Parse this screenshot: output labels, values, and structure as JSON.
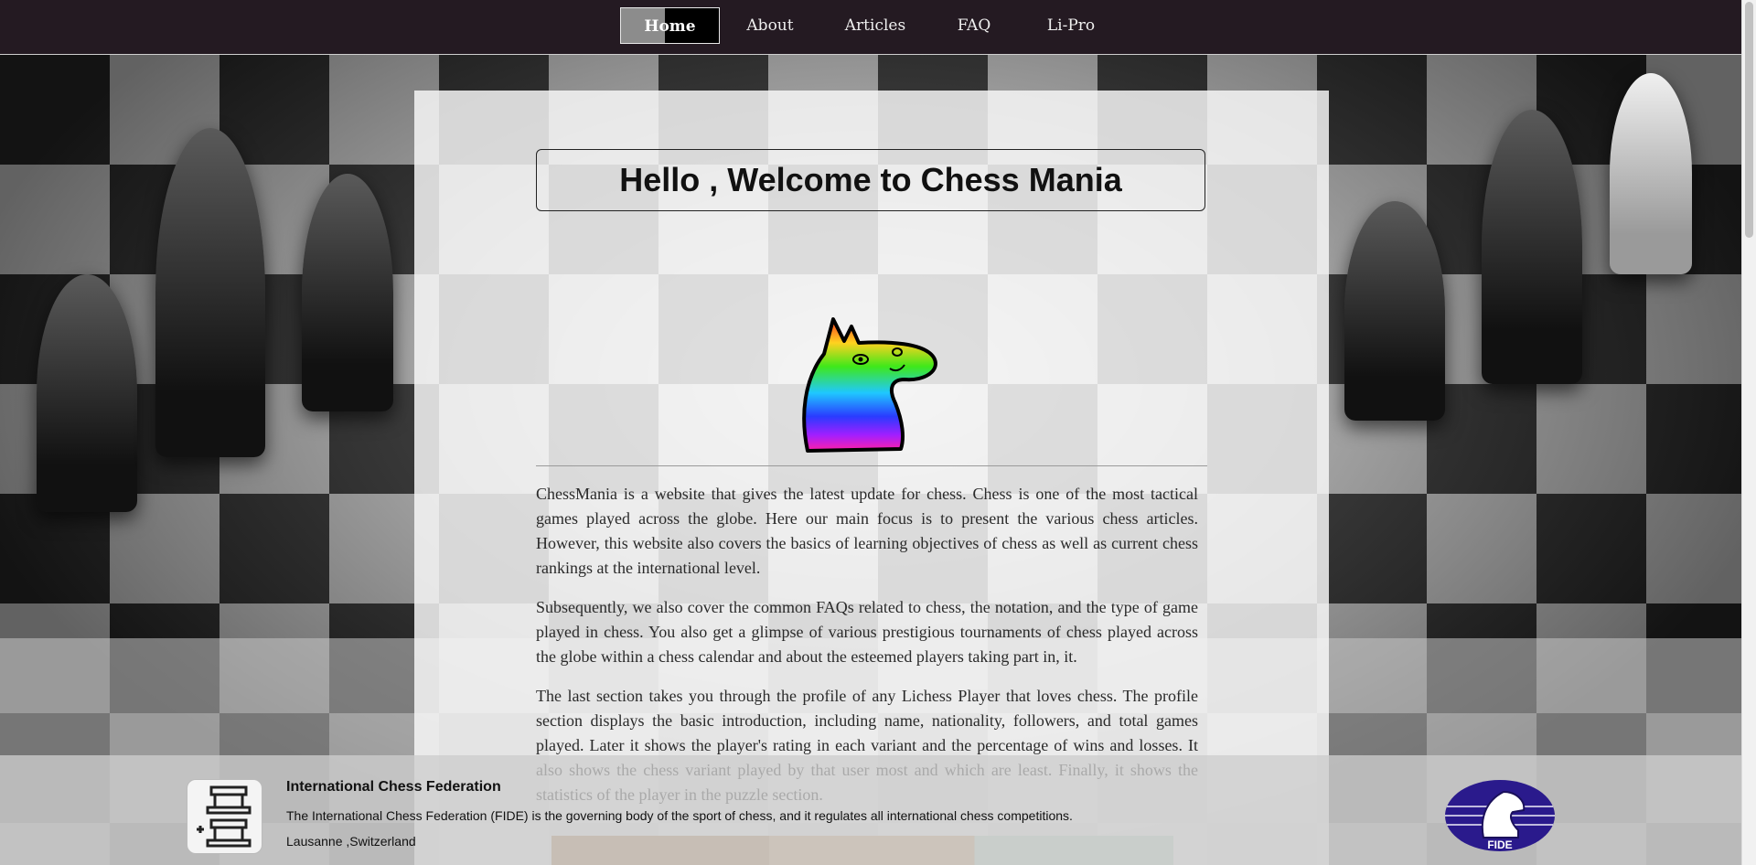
{
  "nav": {
    "items": [
      {
        "label": "Home",
        "active": true
      },
      {
        "label": "About",
        "active": false
      },
      {
        "label": "Articles",
        "active": false
      },
      {
        "label": "FAQ",
        "active": false
      },
      {
        "label": "Li-Pro",
        "active": false
      }
    ]
  },
  "main": {
    "title": "Hello , Welcome to Chess Mania",
    "logo_icon": "rainbow-knight-icon",
    "paragraphs": [
      "ChessMania is a website that gives the latest update for chess. Chess is one of the most tactical games played across the globe. Here our main focus is to present the various chess articles. However, this website also covers the basics of learning objectives of chess as well as current chess rankings at the international level.",
      "Subsequently, we also cover the common FAQs related to chess, the notation, and the type of game played in chess. You also get a glimpse of various prestigious tournaments of chess played across the globe within a chess calendar and about the esteemed players taking part in, it.",
      "The last section takes you through the profile of any Lichess Player that loves chess. The profile section displays the basic introduction, including name, nationality, followers, and total games played. Later it shows the player's rating in each variant and the percentage of wins and losses. It also shows the chess variant played by that user most and which are least. Finally, it shows the statistics of the player in the puzzle section."
    ]
  },
  "footer": {
    "title": "International Chess Federation",
    "description": "The International Chess Federation (FIDE) is the governing body of the sport of chess, and it regulates all international chess competitions.",
    "location": "Lausanne ,Switzerland",
    "left_logo_icon": "rook-pieces-icon",
    "right_logo_icon": "fide-knight-logo",
    "right_logo_text": "FIDE"
  },
  "colors": {
    "navbar_bg": "#241a22",
    "fide_purple": "#2a1a8c"
  }
}
